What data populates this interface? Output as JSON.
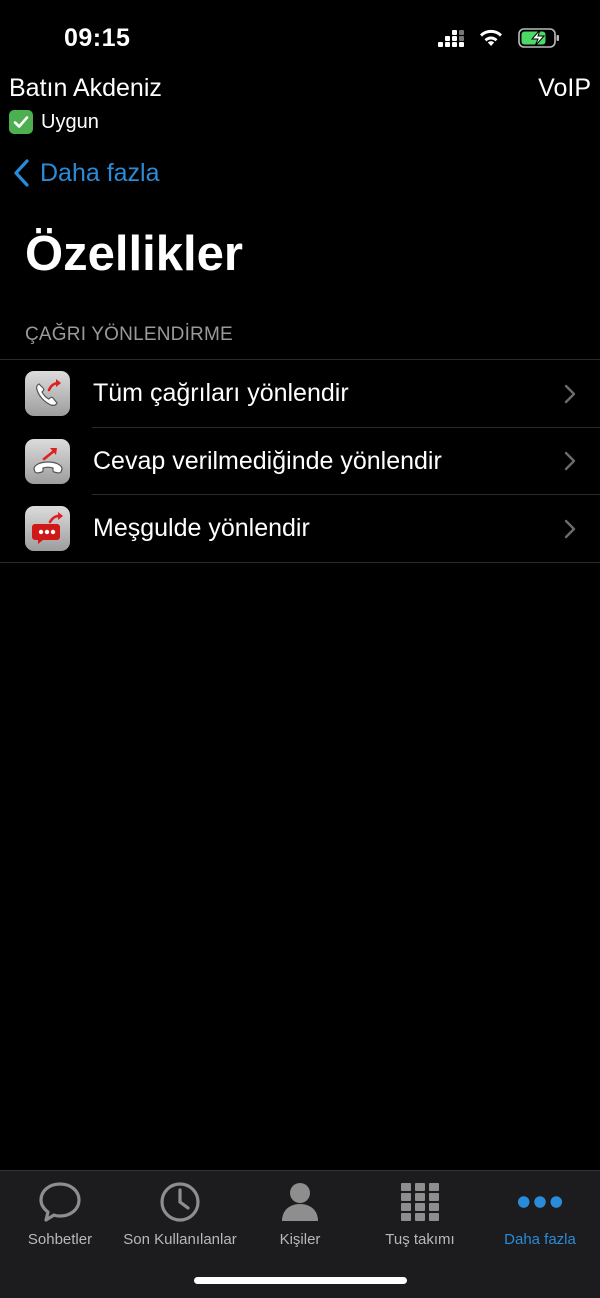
{
  "status_bar": {
    "time": "09:15"
  },
  "header": {
    "account_name": "Batın Akdeniz",
    "presence": "Uygun",
    "connection_type": "VoIP"
  },
  "nav": {
    "back_label": "Daha fazla"
  },
  "page": {
    "title": "Özellikler"
  },
  "section": {
    "header": "ÇAĞRI YÖNLENDİRME",
    "items": [
      {
        "label": "Tüm çağrıları yönlendir",
        "icon": "forward-all-icon"
      },
      {
        "label": "Cevap verilmediğinde yönlendir",
        "icon": "forward-no-answer-icon"
      },
      {
        "label": "Meşgulde yönlendir",
        "icon": "forward-busy-icon"
      }
    ]
  },
  "tab_bar": {
    "tabs": [
      {
        "label": "Sohbetler",
        "icon": "chat-bubble-icon"
      },
      {
        "label": "Son Kullanılanlar",
        "icon": "clock-icon"
      },
      {
        "label": "Kişiler",
        "icon": "person-icon"
      },
      {
        "label": "Tuş takımı",
        "icon": "keypad-icon"
      },
      {
        "label": "Daha fazla",
        "icon": "more-dots-icon",
        "active": true
      }
    ]
  },
  "colors": {
    "accent": "#2a8bd8",
    "background": "#000000",
    "presence_green": "#4caf50",
    "arrow_red": "#e02020"
  }
}
